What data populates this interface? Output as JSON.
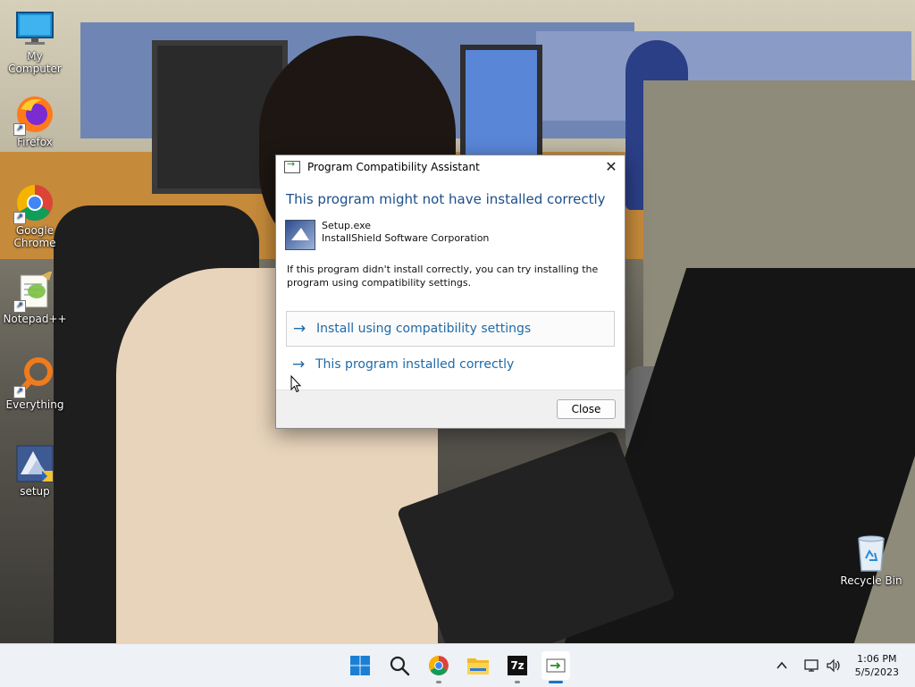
{
  "desktop_icons": [
    {
      "id": "my-computer",
      "label": "My Computer"
    },
    {
      "id": "firefox",
      "label": "Firefox"
    },
    {
      "id": "google-chrome",
      "label": "Google Chrome"
    },
    {
      "id": "notepadpp",
      "label": "Notepad++"
    },
    {
      "id": "everything",
      "label": "Everything"
    },
    {
      "id": "setup",
      "label": "setup"
    },
    {
      "id": "recycle-bin",
      "label": "Recycle Bin"
    }
  ],
  "dialog": {
    "title": "Program Compatibility Assistant",
    "heading": "This program might not have installed correctly",
    "app_name": "Setup.exe",
    "app_publisher": "InstallShield Software Corporation",
    "description": "If this program didn't install correctly, you can try installing the program using compatibility settings.",
    "options": [
      {
        "label": "Install using compatibility settings",
        "arrow": "→"
      },
      {
        "label": "This program installed correctly",
        "arrow": "→"
      }
    ],
    "close_button": "Close",
    "close_glyph": "✕"
  },
  "taskbar": {
    "apps": [
      "start-icon",
      "search-icon",
      "chrome-icon",
      "file-explorer-icon",
      "7zip-icon",
      "program-compatibility-icon"
    ],
    "sevenzip_text": "7z",
    "time": "1:06 PM",
    "date": "5/5/2023"
  },
  "colors": {
    "heading": "#1b4f8a",
    "link": "#1f6aa8",
    "taskbar_bg": "#eef1f5",
    "accent": "#1a73c9"
  }
}
